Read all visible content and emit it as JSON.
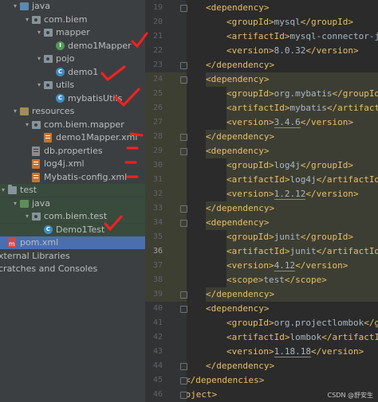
{
  "tree": [
    {
      "label": "java",
      "icon": "source-folder-icon",
      "indent": 1,
      "toggle": "open"
    },
    {
      "label": "com.biem",
      "icon": "package-icon",
      "indent": 2,
      "toggle": "open"
    },
    {
      "label": "mapper",
      "icon": "package-icon",
      "indent": 3,
      "toggle": "open"
    },
    {
      "label": "demo1Mapper",
      "icon": "interface-icon",
      "indent": 4,
      "toggle": ""
    },
    {
      "label": "pojo",
      "icon": "package-icon",
      "indent": 3,
      "toggle": "open"
    },
    {
      "label": "demo1",
      "icon": "class-icon",
      "indent": 4,
      "toggle": ""
    },
    {
      "label": "utils",
      "icon": "package-icon",
      "indent": 3,
      "toggle": "open"
    },
    {
      "label": "mybatisUtils",
      "icon": "class-icon",
      "indent": 4,
      "toggle": ""
    },
    {
      "label": "resources",
      "icon": "resources-folder-icon",
      "indent": 1,
      "toggle": "open"
    },
    {
      "label": "com.biem.mapper",
      "icon": "package-icon",
      "indent": 2,
      "toggle": "open"
    },
    {
      "label": "demo1Mapper.xml",
      "icon": "xml-file-icon",
      "indent": 3,
      "toggle": ""
    },
    {
      "label": "db.properties",
      "icon": "properties-file-icon",
      "indent": 2,
      "toggle": ""
    },
    {
      "label": "log4j.xml",
      "icon": "xml-file-icon",
      "indent": 2,
      "toggle": ""
    },
    {
      "label": "Mybatis-config.xml",
      "icon": "xml-file-icon",
      "indent": 2,
      "toggle": ""
    },
    {
      "label": "test",
      "icon": "folder-icon",
      "indent": 0,
      "toggle": "open"
    },
    {
      "label": "java",
      "icon": "test-folder-icon",
      "indent": 1,
      "toggle": "open"
    },
    {
      "label": "com.biem.test",
      "icon": "package-icon",
      "indent": 2,
      "toggle": "open"
    },
    {
      "label": "Demo1Test",
      "icon": "class-icon",
      "indent": 3,
      "toggle": ""
    },
    {
      "label": "pom.xml",
      "icon": "maven-pom-icon",
      "indent": 0,
      "toggle": ""
    },
    {
      "label": "xternal Libraries",
      "icon": "",
      "indent": -1,
      "toggle": ""
    },
    {
      "label": "cratches and Consoles",
      "icon": "",
      "indent": -1,
      "toggle": ""
    }
  ],
  "selected_tree_item": "pom.xml",
  "editor": {
    "current_line": 36,
    "lines": [
      {
        "n": 19,
        "ind": 2,
        "parts": [
          [
            "t",
            "<dependency>"
          ]
        ]
      },
      {
        "n": 20,
        "ind": 3,
        "parts": [
          [
            "t",
            "<groupId>"
          ],
          [
            "v",
            "mysql"
          ],
          [
            "t",
            "</groupId>"
          ]
        ]
      },
      {
        "n": 21,
        "ind": 3,
        "parts": [
          [
            "t",
            "<artifactId>"
          ],
          [
            "v",
            "mysql-connector-java"
          ],
          [
            "t",
            "</artifactId>"
          ]
        ]
      },
      {
        "n": 22,
        "ind": 3,
        "parts": [
          [
            "t",
            "<version>"
          ],
          [
            "v",
            "8.0.32"
          ],
          [
            "t",
            "</version>"
          ]
        ]
      },
      {
        "n": 23,
        "ind": 2,
        "parts": [
          [
            "t",
            "</dependency>"
          ]
        ]
      },
      {
        "n": 24,
        "ind": 2,
        "parts": [
          [
            "t",
            "<dependency>"
          ]
        ]
      },
      {
        "n": 25,
        "ind": 3,
        "parts": [
          [
            "t",
            "<groupId>"
          ],
          [
            "v",
            "org.mybatis"
          ],
          [
            "t",
            "</groupId>"
          ]
        ]
      },
      {
        "n": 26,
        "ind": 3,
        "parts": [
          [
            "t",
            "<artifactId>"
          ],
          [
            "v",
            "mybatis"
          ],
          [
            "t",
            "</artifactId>"
          ]
        ]
      },
      {
        "n": 27,
        "ind": 3,
        "parts": [
          [
            "t",
            "<version>"
          ],
          [
            "u",
            "3.4.6"
          ],
          [
            "t",
            "</version>"
          ]
        ]
      },
      {
        "n": 28,
        "ind": 2,
        "parts": [
          [
            "t",
            "</dependency>"
          ]
        ]
      },
      {
        "n": 29,
        "ind": 2,
        "parts": [
          [
            "t",
            "<dependency>"
          ]
        ]
      },
      {
        "n": 30,
        "ind": 3,
        "parts": [
          [
            "t",
            "<groupId>"
          ],
          [
            "v",
            "log4j"
          ],
          [
            "t",
            "</groupId>"
          ]
        ]
      },
      {
        "n": 31,
        "ind": 3,
        "parts": [
          [
            "t",
            "<artifactId>"
          ],
          [
            "v",
            "log4j"
          ],
          [
            "t",
            "</artifactId>"
          ]
        ]
      },
      {
        "n": 32,
        "ind": 3,
        "parts": [
          [
            "t",
            "<version>"
          ],
          [
            "u",
            "1.2.12"
          ],
          [
            "t",
            "</version>"
          ]
        ]
      },
      {
        "n": 33,
        "ind": 2,
        "parts": [
          [
            "t",
            "</dependency>"
          ]
        ]
      },
      {
        "n": 34,
        "ind": 2,
        "parts": [
          [
            "t",
            "<dependency>"
          ]
        ]
      },
      {
        "n": 35,
        "ind": 3,
        "parts": [
          [
            "t",
            "<groupId>"
          ],
          [
            "v",
            "junit"
          ],
          [
            "t",
            "</groupId>"
          ]
        ]
      },
      {
        "n": 36,
        "ind": 3,
        "parts": [
          [
            "t",
            "<artifactId>"
          ],
          [
            "v",
            "junit"
          ],
          [
            "t",
            "</artifactId>"
          ]
        ]
      },
      {
        "n": 37,
        "ind": 3,
        "parts": [
          [
            "t",
            "<version>"
          ],
          [
            "u",
            "4.12"
          ],
          [
            "t",
            "</version>"
          ]
        ]
      },
      {
        "n": 38,
        "ind": 3,
        "parts": [
          [
            "t",
            "<scope>"
          ],
          [
            "v",
            "test"
          ],
          [
            "t",
            "</scope>"
          ]
        ]
      },
      {
        "n": 39,
        "ind": 2,
        "parts": [
          [
            "t",
            "</dependency>"
          ]
        ]
      },
      {
        "n": 40,
        "ind": 2,
        "parts": [
          [
            "t",
            "<dependency>"
          ]
        ]
      },
      {
        "n": 41,
        "ind": 3,
        "parts": [
          [
            "t",
            "<groupId>"
          ],
          [
            "v",
            "org.projectlombok"
          ],
          [
            "t",
            "</groupId>"
          ]
        ]
      },
      {
        "n": 42,
        "ind": 3,
        "parts": [
          [
            "t",
            "<artifactId>"
          ],
          [
            "v",
            "lombok"
          ],
          [
            "t",
            "</artifactId>"
          ]
        ]
      },
      {
        "n": 43,
        "ind": 3,
        "parts": [
          [
            "t",
            "<version>"
          ],
          [
            "u",
            "1.18.18"
          ],
          [
            "t",
            "</version>"
          ]
        ]
      },
      {
        "n": 44,
        "ind": 2,
        "parts": [
          [
            "t",
            "</dependency>"
          ]
        ]
      },
      {
        "n": 45,
        "ind": 1,
        "parts": [
          [
            "t",
            "</dependencies>"
          ]
        ]
      },
      {
        "n": 46,
        "ind": 0,
        "parts": [
          [
            "t",
            "</project>"
          ]
        ]
      }
    ]
  },
  "watermark": "CSDN @舒安生",
  "colors": {
    "tag": "#e8bf6a",
    "text": "#a9b7c6",
    "selection": "#4b6eaf",
    "annotation": "#ff1f1f"
  }
}
